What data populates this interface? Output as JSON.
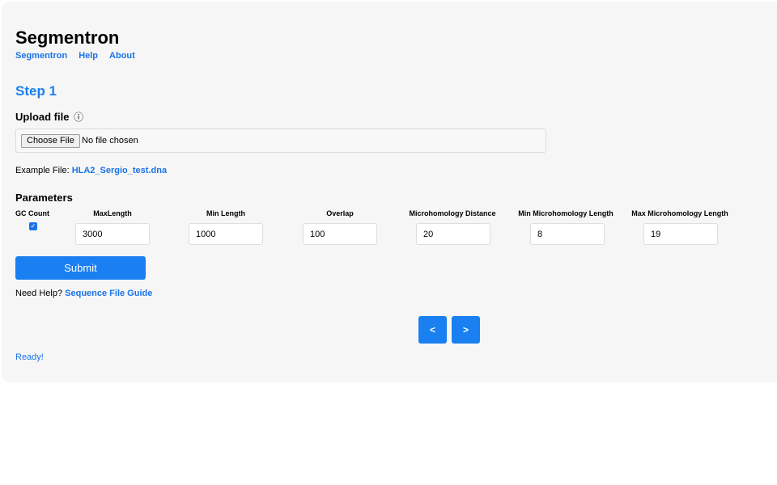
{
  "app": {
    "title": "Segmentron"
  },
  "nav": {
    "items": [
      "Segmentron",
      "Help",
      "About"
    ]
  },
  "step": {
    "title": "Step 1"
  },
  "upload": {
    "label": "Upload file",
    "info_icon": "ⓘ",
    "choose_button": "Choose File",
    "file_status": "No file chosen"
  },
  "example": {
    "prefix": "Example File:",
    "link": "HLA2_Sergio_test.dna"
  },
  "parameters": {
    "title": "Parameters",
    "gc_count": {
      "label": "GC Count",
      "checked": true
    },
    "fields": [
      {
        "label": "MaxLength",
        "value": "3000"
      },
      {
        "label": "Min Length",
        "value": "1000"
      },
      {
        "label": "Overlap",
        "value": "100"
      },
      {
        "label": "Microhomology Distance",
        "value": "20"
      },
      {
        "label": "Min Microhomology Length",
        "value": "8"
      },
      {
        "label": "Max Microhomology Length",
        "value": "19"
      }
    ]
  },
  "actions": {
    "submit": "Submit"
  },
  "help": {
    "prefix": "Need Help?",
    "link": "Sequence File Guide"
  },
  "pager": {
    "prev": "<",
    "next": ">"
  },
  "status": {
    "text": "Ready!"
  },
  "colors": {
    "accent": "#1a7ff0",
    "link": "#1a73e8",
    "panel": "#f6f6f6"
  }
}
